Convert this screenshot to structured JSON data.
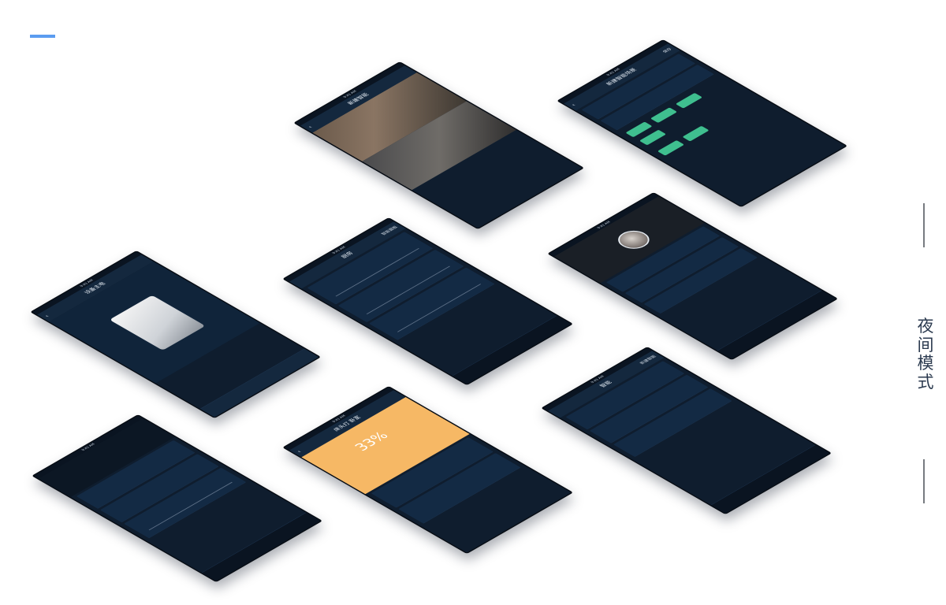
{
  "side_label": "夜间模式",
  "colors": {
    "accent": "#5b9cf0",
    "screen_bg": "#0f1d2e",
    "green": "#3fbf8f",
    "orange": "#f6b865"
  },
  "screens": {
    "scene_select": {
      "status": "9:41 AM",
      "title": "新建智能"
    },
    "scene_edit": {
      "status": "9:41 AM",
      "title": "新建智能场景",
      "right": "保存"
    },
    "add_device": {
      "status": "9:41 AM",
      "title": "设备主电"
    },
    "lights": {
      "status": "9:41 AM",
      "title": "厨房",
      "right": "智能面板"
    },
    "profile": {
      "status": "9:41 AM"
    },
    "intelligent": {
      "status": "9:41 AM",
      "title": "智能",
      "right": "新建智能"
    },
    "home": {
      "status": "9:41 AM"
    },
    "curtain": {
      "status": "9:41 AM",
      "title": "床头灯 卧室",
      "percent": "33%"
    }
  }
}
